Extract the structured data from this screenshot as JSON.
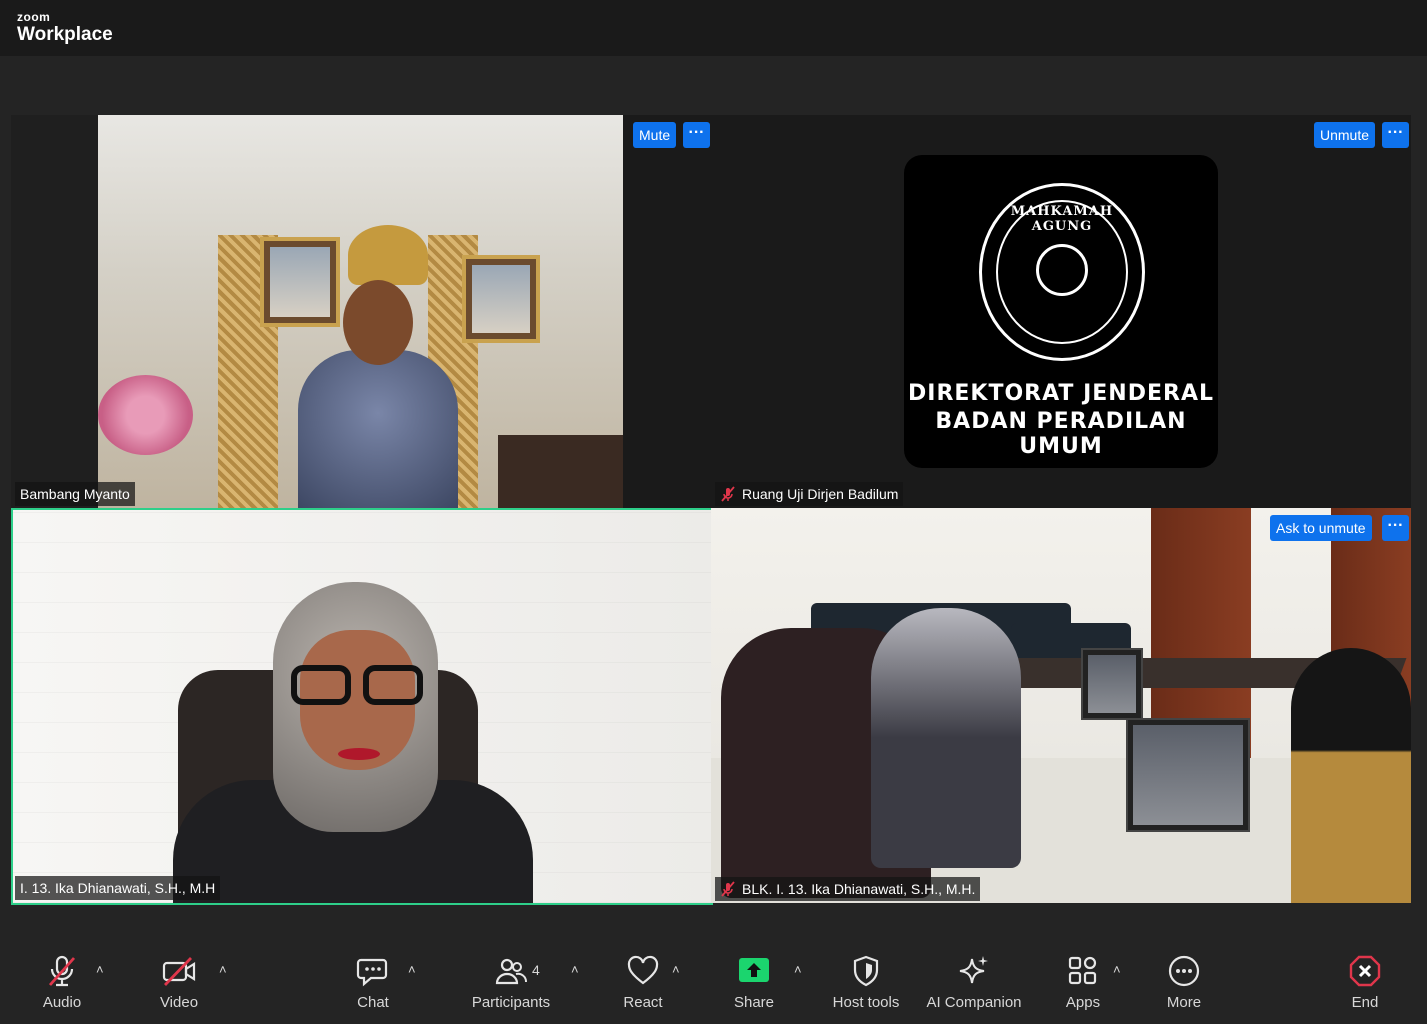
{
  "app": {
    "brand_small": "zoom",
    "brand_big": "Workplace"
  },
  "tiles": [
    {
      "name": "Bambang Myanto",
      "muted": false
    },
    {
      "name": "Ruang Uji Dirjen Badilum",
      "muted": true,
      "mute_label": "Mute",
      "unmute_label": "Unmute",
      "more": "···",
      "logo": {
        "seal_text": "MAHKAMAH AGUNG",
        "line1": "DIREKTORAT JENDERAL",
        "line2": "BADAN PERADILAN UMUM"
      }
    },
    {
      "name": "I. 13. Ika Dhianawati, S.H., M.H",
      "muted": false,
      "active_speaker": true
    },
    {
      "name": "BLK. I. 13. Ika Dhianawati, S.H., M.H.",
      "muted": true,
      "ask_label": "Ask to unmute",
      "more": "···"
    }
  ],
  "toolbar": {
    "audio": "Audio",
    "video": "Video",
    "chat": "Chat",
    "participants": "Participants",
    "participants_count": "4",
    "react": "React",
    "share": "Share",
    "host_tools": "Host tools",
    "ai_companion": "AI Companion",
    "apps": "Apps",
    "more": "More",
    "end": "End",
    "caret": "˄"
  },
  "colors": {
    "accent": "#0e72ed",
    "active_border": "#2ecf8a",
    "share_green": "#1bd56e",
    "end_red": "#e0364b",
    "muted_red": "#e0364b"
  }
}
